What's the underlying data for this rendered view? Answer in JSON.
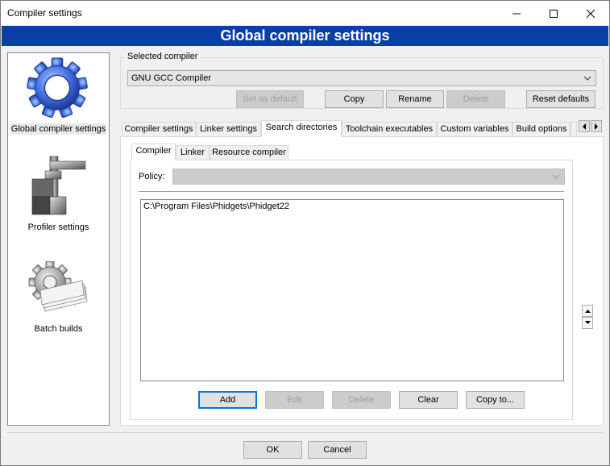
{
  "window": {
    "title": "Compiler settings",
    "banner": "Global compiler settings"
  },
  "sidebar": {
    "items": [
      {
        "label": "Global compiler settings",
        "icon": "gear-icon",
        "selected": true
      },
      {
        "label": "Profiler settings",
        "icon": "profiler-icon",
        "selected": false
      },
      {
        "label": "Batch builds",
        "icon": "batch-builds-icon",
        "selected": false
      }
    ]
  },
  "selected_compiler": {
    "group_label": "Selected compiler",
    "value": "GNU GCC Compiler",
    "buttons": {
      "set_default": "Set as default",
      "copy": "Copy",
      "rename": "Rename",
      "delete": "Delete",
      "reset": "Reset defaults"
    }
  },
  "tabs": [
    {
      "label": "Compiler settings",
      "active": false
    },
    {
      "label": "Linker settings",
      "active": false
    },
    {
      "label": "Search directories",
      "active": true
    },
    {
      "label": "Toolchain executables",
      "active": false
    },
    {
      "label": "Custom variables",
      "active": false
    },
    {
      "label": "Build options",
      "active": false
    }
  ],
  "subtabs": [
    {
      "label": "Compiler",
      "active": true
    },
    {
      "label": "Linker",
      "active": false
    },
    {
      "label": "Resource compiler",
      "active": false
    }
  ],
  "policy": {
    "label": "Policy:",
    "value": ""
  },
  "directories": [
    "C:\\Program Files\\Phidgets\\Phidget22"
  ],
  "dir_buttons": {
    "add": "Add",
    "edit": "Edit",
    "delete": "Delete",
    "clear": "Clear",
    "copy_to": "Copy to..."
  },
  "dialog_buttons": {
    "ok": "OK",
    "cancel": "Cancel"
  },
  "colors": {
    "banner": "#0a3fa8",
    "focus": "#0078d7"
  }
}
